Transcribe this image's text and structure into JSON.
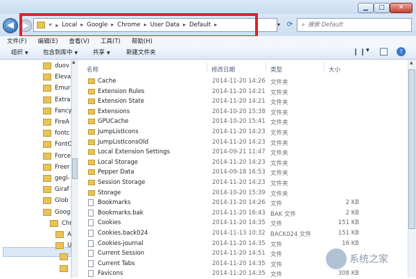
{
  "window": {
    "minimize_glyph": "▁",
    "maximize_glyph": "□",
    "close_glyph": "✕"
  },
  "address": {
    "overflow": "«",
    "crumbs": [
      "Local",
      "Google",
      "Chrome",
      "User Data",
      "Default"
    ],
    "separator": "▸"
  },
  "search": {
    "placeholder": "搜索 Default"
  },
  "menu": [
    "文件(F)",
    "编辑(E)",
    "查看(V)",
    "工具(T)",
    "帮助(H)"
  ],
  "toolbar": {
    "organize": "组织",
    "include_in_library": "包含到库中",
    "share": "共享",
    "new_folder": "新建文件夹"
  },
  "nav_tree": [
    {
      "label": "duov"
    },
    {
      "label": "Eleva"
    },
    {
      "label": "Emur"
    },
    {
      "label": "Extra"
    },
    {
      "label": "Fancy"
    },
    {
      "label": "FireA"
    },
    {
      "label": "fontc"
    },
    {
      "label": "FontC"
    },
    {
      "label": "Force"
    },
    {
      "label": "Freer"
    },
    {
      "label": "gegl-"
    },
    {
      "label": "Giraf"
    },
    {
      "label": "Glob"
    },
    {
      "label": "Goog"
    },
    {
      "label": "Chr"
    },
    {
      "label": "A"
    },
    {
      "label": "U"
    },
    {
      "label": ""
    },
    {
      "label": ""
    }
  ],
  "columns": {
    "name": "名称",
    "date": "修改日期",
    "type": "类型",
    "size": "大小"
  },
  "files": [
    {
      "name": "Cache",
      "date": "2014-11-20 14:26",
      "type": "文件夹",
      "size": "",
      "kind": "folder"
    },
    {
      "name": "Extension Rules",
      "date": "2014-11-20 14:21",
      "type": "文件夹",
      "size": "",
      "kind": "folder"
    },
    {
      "name": "Extension State",
      "date": "2014-11-20 14:21",
      "type": "文件夹",
      "size": "",
      "kind": "folder"
    },
    {
      "name": "Extensions",
      "date": "2014-10-20 15:38",
      "type": "文件夹",
      "size": "",
      "kind": "folder"
    },
    {
      "name": "GPUCache",
      "date": "2014-10-20 15:41",
      "type": "文件夹",
      "size": "",
      "kind": "folder"
    },
    {
      "name": "JumpListIcons",
      "date": "2014-11-20 14:23",
      "type": "文件夹",
      "size": "",
      "kind": "folder"
    },
    {
      "name": "JumpListIconsOld",
      "date": "2014-11-20 14:23",
      "type": "文件夹",
      "size": "",
      "kind": "folder"
    },
    {
      "name": "Local Extension Settings",
      "date": "2014-09-21 11:47",
      "type": "文件夹",
      "size": "",
      "kind": "folder"
    },
    {
      "name": "Local Storage",
      "date": "2014-11-20 14:23",
      "type": "文件夹",
      "size": "",
      "kind": "folder"
    },
    {
      "name": "Pepper Data",
      "date": "2014-09-18 16:53",
      "type": "文件夹",
      "size": "",
      "kind": "folder"
    },
    {
      "name": "Session Storage",
      "date": "2014-11-20 14:23",
      "type": "文件夹",
      "size": "",
      "kind": "folder"
    },
    {
      "name": "Storage",
      "date": "2014-10-20 15:39",
      "type": "文件夹",
      "size": "",
      "kind": "folder"
    },
    {
      "name": "Bookmarks",
      "date": "2014-11-20 14:26",
      "type": "文件",
      "size": "2 KB",
      "kind": "file"
    },
    {
      "name": "Bookmarks.bak",
      "date": "2014-11-20 16:43",
      "type": "BAK 文件",
      "size": "2 KB",
      "kind": "file"
    },
    {
      "name": "Cookies",
      "date": "2014-11-20 14:35",
      "type": "文件",
      "size": "151 KB",
      "kind": "file"
    },
    {
      "name": "Cookies.back024",
      "date": "2014-11-13 10:32",
      "type": "BACK024 文件",
      "size": "151 KB",
      "kind": "file"
    },
    {
      "name": "Cookies-journal",
      "date": "2014-11-20 14:35",
      "type": "文件",
      "size": "16 KB",
      "kind": "file"
    },
    {
      "name": "Current Session",
      "date": "2014-11-20 14:51",
      "type": "文件",
      "size": "",
      "kind": "file"
    },
    {
      "name": "Current Tabs",
      "date": "2014-11-20 14:35",
      "type": "文件",
      "size": "",
      "kind": "file"
    },
    {
      "name": "Favicons",
      "date": "2014-11-20 14:35",
      "type": "文件",
      "size": "308 KB",
      "kind": "file"
    }
  ],
  "watermark": {
    "brand": "系统之家"
  }
}
